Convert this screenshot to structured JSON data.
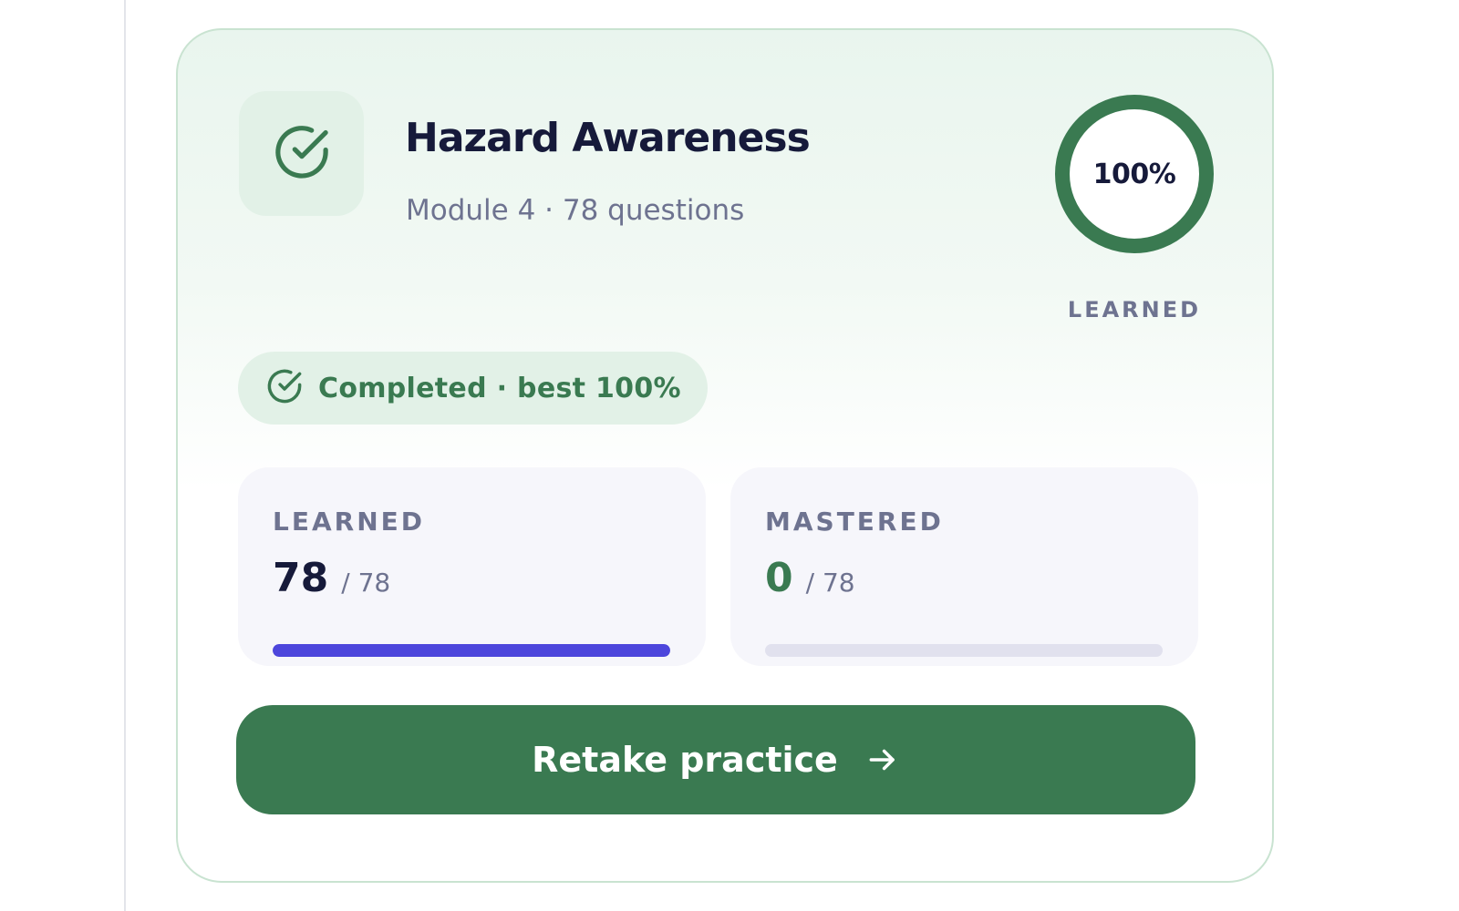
{
  "card": {
    "title": "Hazard Awareness",
    "subtitle": "Module 4 · 78 questions",
    "icon": "check-circle-icon",
    "progress": {
      "percent_text": "100%",
      "fraction": 1.0,
      "caption": "LEARNED"
    },
    "status": {
      "icon": "check-circle-icon",
      "text": "Completed · best 100%"
    },
    "stats": [
      {
        "label": "LEARNED",
        "value": "78",
        "total": "/ 78",
        "fraction": 1.0,
        "value_color": "#161a3a",
        "bar_color": "#4d46dc"
      },
      {
        "label": "MASTERED",
        "value": "0",
        "total": "/ 78",
        "fraction": 0.0,
        "value_color": "#3a7a51",
        "bar_color": "#4d46dc"
      }
    ],
    "action": {
      "label": "Retake practice",
      "icon": "arrow-right-icon"
    }
  },
  "colors": {
    "accent_green": "#3a7a51",
    "ring_green": "#3a7a51",
    "pill_bg": "#e2f1e7",
    "card_border": "#c9e3d1",
    "text_dark": "#161a3a",
    "text_muted": "#6e7390",
    "progress_indigo": "#4d46dc",
    "track": "#e1e1ee"
  }
}
